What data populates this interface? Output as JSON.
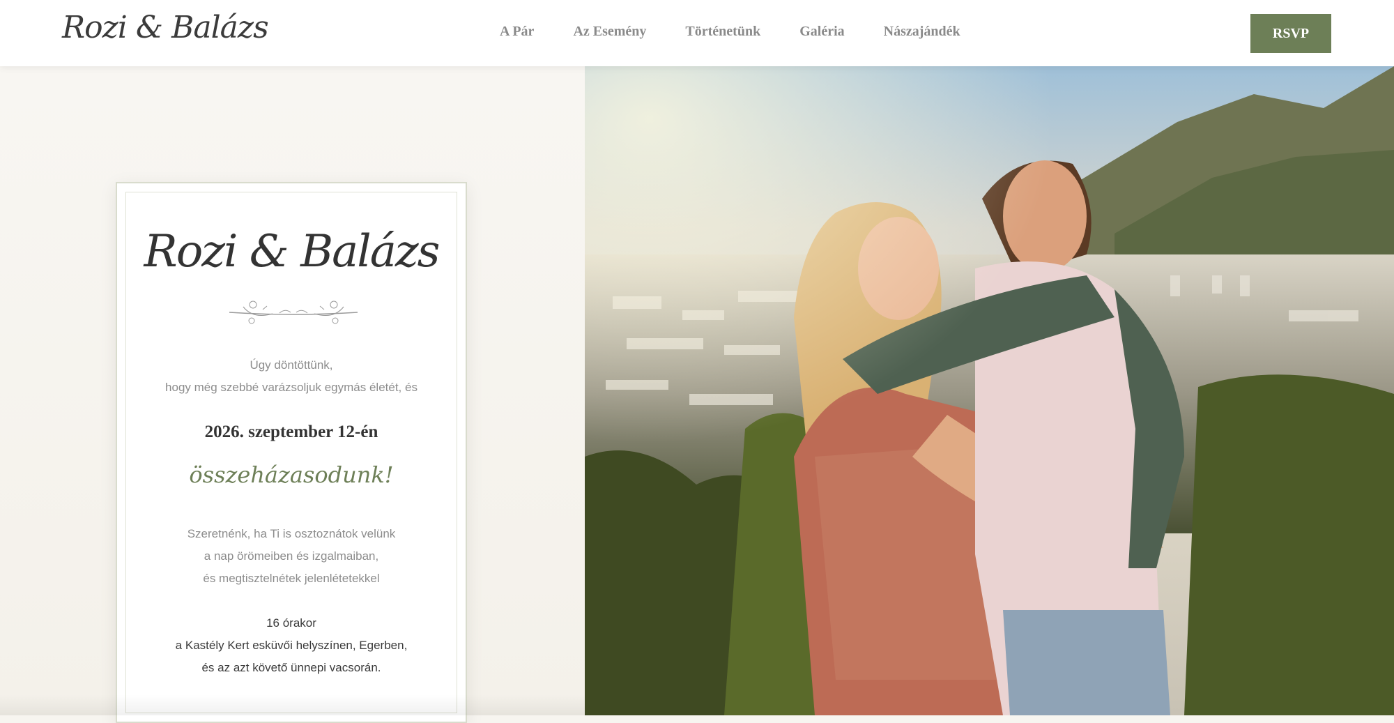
{
  "header": {
    "logo": "Rozi & Balázs",
    "nav": [
      "A Pár",
      "Az Esemény",
      "Történetünk",
      "Galéria",
      "Nászajándék"
    ],
    "rsvp_label": "RSVP"
  },
  "invitation": {
    "title": "Rozi & Balázs",
    "intro": [
      "Úgy döntöttünk,",
      "hogy még szebbé varázsoljuk egymás életét, és"
    ],
    "date": "2026. szeptember 12-én",
    "married": "összeházasodunk!",
    "invite": [
      "Szeretnénk, ha Ti is osztoznátok velünk",
      "a nap örömeiben és izgalmaiban,",
      "és megtisztelnétek jelenlétetekkel"
    ],
    "details": [
      "16 órakor",
      "a Kastély Kert esküvői helyszínen, Egerben,",
      "és az azt követő ünnepi vacsorán."
    ]
  },
  "colors": {
    "accent": "#6d7f57",
    "background": "#f7f5f0",
    "text_dark": "#333333",
    "text_muted": "#8c8c8c"
  },
  "hero_photo": {
    "icon": "couple-photo"
  }
}
